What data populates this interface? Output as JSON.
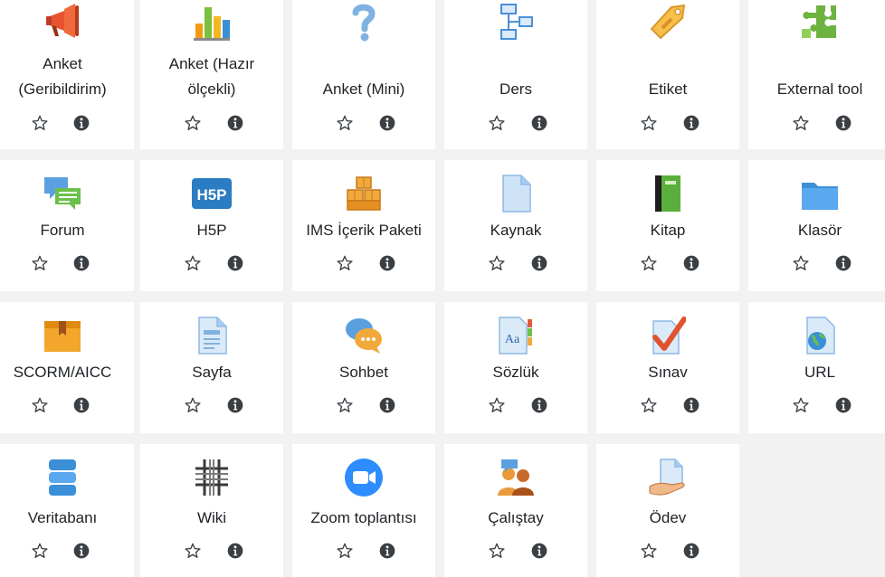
{
  "modules": [
    {
      "lines": [
        "Anket",
        "(Geribildirim)"
      ],
      "icon": "megaphone-icon"
    },
    {
      "lines": [
        "Anket (Hazır",
        "ölçekli)"
      ],
      "icon": "bar-chart-icon"
    },
    {
      "lines": [
        "Anket (Mini)"
      ],
      "icon": "question-mark-icon"
    },
    {
      "lines": [
        "Ders"
      ],
      "icon": "flowchart-icon"
    },
    {
      "lines": [
        "Etiket"
      ],
      "icon": "tag-icon"
    },
    {
      "lines": [
        "External tool"
      ],
      "icon": "puzzle-icon"
    },
    {
      "lines": [
        "Forum"
      ],
      "icon": "chat-bubbles-icon"
    },
    {
      "lines": [
        "H5P"
      ],
      "icon": "h5p-icon"
    },
    {
      "lines": [
        "IMS İçerik Paketi"
      ],
      "icon": "boxes-icon"
    },
    {
      "lines": [
        "Kaynak"
      ],
      "icon": "file-icon"
    },
    {
      "lines": [
        "Kitap"
      ],
      "icon": "book-icon"
    },
    {
      "lines": [
        "Klasör"
      ],
      "icon": "folder-icon"
    },
    {
      "lines": [
        "SCORM/AICC"
      ],
      "icon": "package-icon"
    },
    {
      "lines": [
        "Sayfa"
      ],
      "icon": "page-icon"
    },
    {
      "lines": [
        "Sohbet"
      ],
      "icon": "chat-icon"
    },
    {
      "lines": [
        "Sözlük"
      ],
      "icon": "glossary-icon"
    },
    {
      "lines": [
        "Sınav"
      ],
      "icon": "quiz-checkmark-icon"
    },
    {
      "lines": [
        "URL"
      ],
      "icon": "globe-file-icon"
    },
    {
      "lines": [
        "Veritabanı"
      ],
      "icon": "database-icon"
    },
    {
      "lines": [
        "Wiki"
      ],
      "icon": "wiki-icon"
    },
    {
      "lines": [
        "Zoom toplantısı"
      ],
      "icon": "video-camera-icon"
    },
    {
      "lines": [
        "Çalıştay"
      ],
      "icon": "workshop-people-icon"
    },
    {
      "lines": [
        "Ödev"
      ],
      "icon": "assignment-hand-icon"
    }
  ],
  "colors": {
    "background": "#f2f2f2",
    "tile": "#ffffff",
    "text": "#1d2125",
    "action_icon": "#3a3f44"
  }
}
